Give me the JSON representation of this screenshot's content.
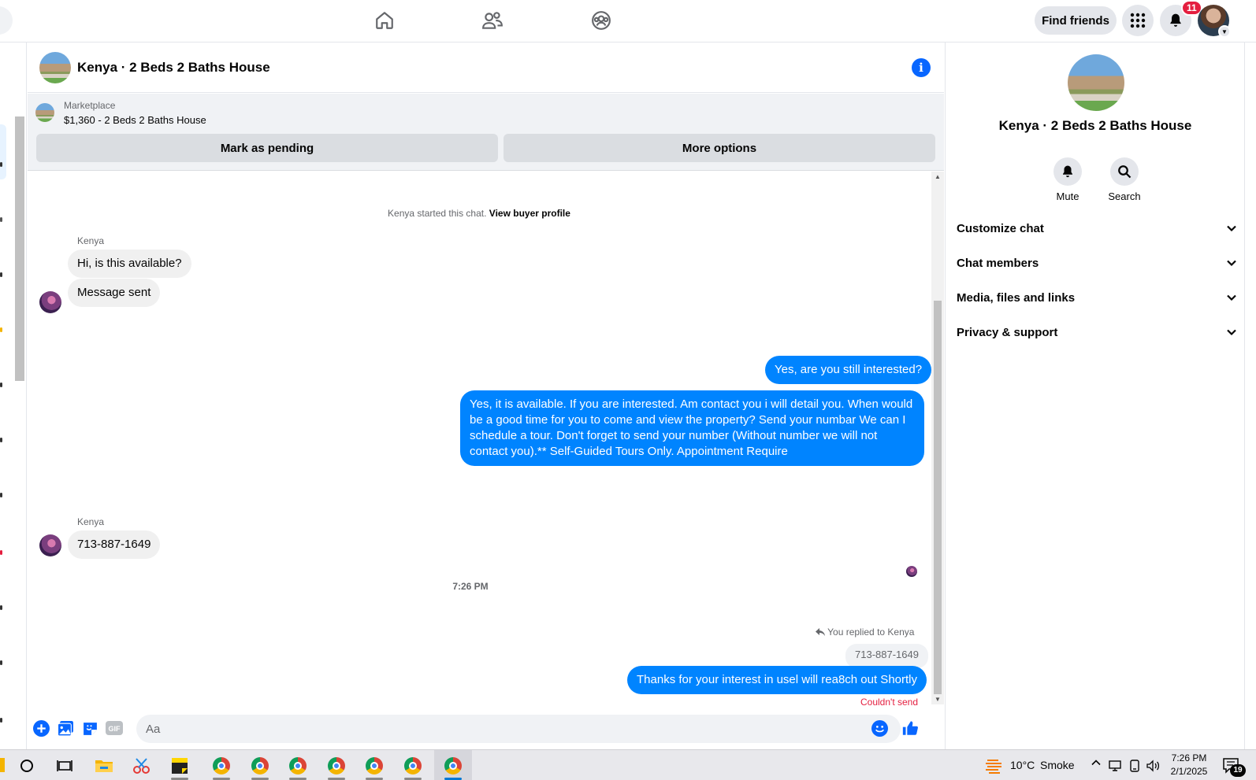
{
  "topnav": {
    "find_friends": "Find friends",
    "notification_count": "11"
  },
  "conversation": {
    "title": "Kenya · 2 Beds 2 Baths House",
    "marketplace_label": "Marketplace",
    "listing": "$1,360 - 2 Beds 2 Baths House",
    "mark_pending": "Mark as pending",
    "more_options": "More options"
  },
  "messages": {
    "started_text": "Kenya started this chat.",
    "view_buyer_profile": "View buyer profile",
    "sender": "Kenya",
    "in_1": "Hi, is this available?",
    "in_2": "Message sent",
    "out_1": "Yes, are you still interested?",
    "out_2": "Yes, it is available. If you are interested.  Am contact you i will detail you.  When would be a good time for you to come and view the property? Send your numbar We can I schedule a tour.  Don't forget to send your number (Without number we will not contact you).** Self-Guided Tours Only. Appointment Require",
    "in_3": "713-887-1649",
    "timestamp": "7:26 PM",
    "replied_label": "You replied to Kenya",
    "quoted": "713-887-1649",
    "out_3": "Thanks for your interest in usel will rea8ch out Shortly",
    "couldnt_send": "Couldn't send"
  },
  "composer": {
    "placeholder": "Aa"
  },
  "right_panel": {
    "title": "Kenya · 2 Beds 2 Baths House",
    "mute": "Mute",
    "search": "Search",
    "sections": [
      "Customize chat",
      "Chat members",
      "Media, files and links",
      "Privacy & support"
    ]
  },
  "taskbar": {
    "temperature": "10°C",
    "weather": "Smoke",
    "time": "7:26 PM",
    "date": "2/1/2025",
    "notification_count": "19"
  },
  "colors": {
    "accent": "#0084ff",
    "brand_blue": "#0866ff",
    "error": "#e41e3f"
  }
}
